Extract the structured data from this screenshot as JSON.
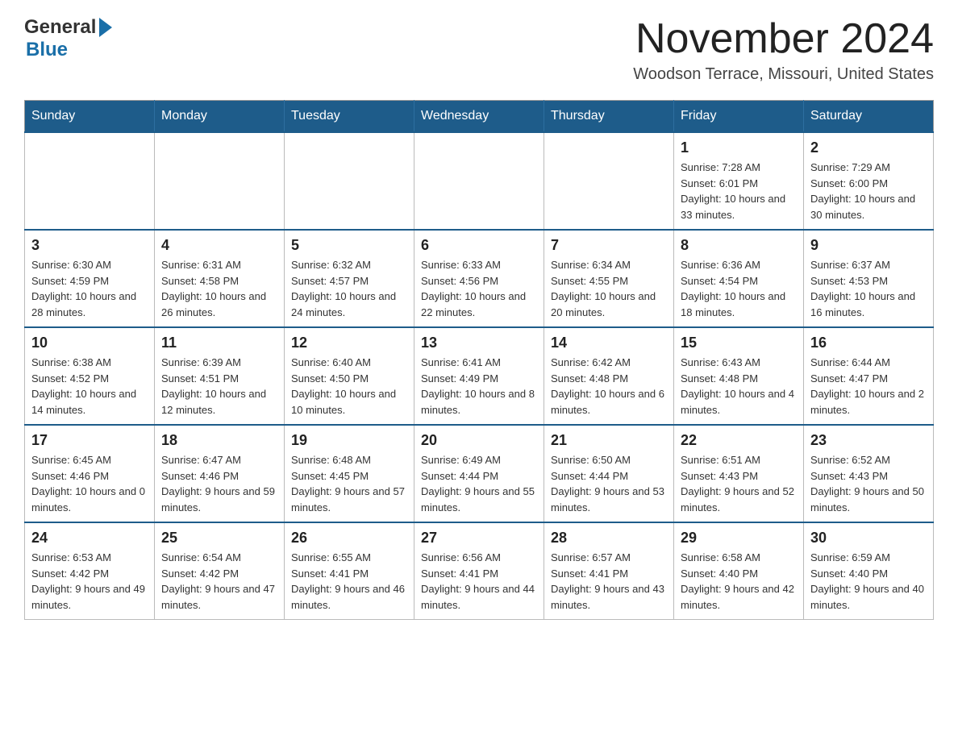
{
  "header": {
    "logo_general": "General",
    "logo_blue": "Blue",
    "month_title": "November 2024",
    "location": "Woodson Terrace, Missouri, United States"
  },
  "weekdays": [
    "Sunday",
    "Monday",
    "Tuesday",
    "Wednesday",
    "Thursday",
    "Friday",
    "Saturday"
  ],
  "weeks": [
    [
      {
        "day": "",
        "info": ""
      },
      {
        "day": "",
        "info": ""
      },
      {
        "day": "",
        "info": ""
      },
      {
        "day": "",
        "info": ""
      },
      {
        "day": "",
        "info": ""
      },
      {
        "day": "1",
        "info": "Sunrise: 7:28 AM\nSunset: 6:01 PM\nDaylight: 10 hours and 33 minutes."
      },
      {
        "day": "2",
        "info": "Sunrise: 7:29 AM\nSunset: 6:00 PM\nDaylight: 10 hours and 30 minutes."
      }
    ],
    [
      {
        "day": "3",
        "info": "Sunrise: 6:30 AM\nSunset: 4:59 PM\nDaylight: 10 hours and 28 minutes."
      },
      {
        "day": "4",
        "info": "Sunrise: 6:31 AM\nSunset: 4:58 PM\nDaylight: 10 hours and 26 minutes."
      },
      {
        "day": "5",
        "info": "Sunrise: 6:32 AM\nSunset: 4:57 PM\nDaylight: 10 hours and 24 minutes."
      },
      {
        "day": "6",
        "info": "Sunrise: 6:33 AM\nSunset: 4:56 PM\nDaylight: 10 hours and 22 minutes."
      },
      {
        "day": "7",
        "info": "Sunrise: 6:34 AM\nSunset: 4:55 PM\nDaylight: 10 hours and 20 minutes."
      },
      {
        "day": "8",
        "info": "Sunrise: 6:36 AM\nSunset: 4:54 PM\nDaylight: 10 hours and 18 minutes."
      },
      {
        "day": "9",
        "info": "Sunrise: 6:37 AM\nSunset: 4:53 PM\nDaylight: 10 hours and 16 minutes."
      }
    ],
    [
      {
        "day": "10",
        "info": "Sunrise: 6:38 AM\nSunset: 4:52 PM\nDaylight: 10 hours and 14 minutes."
      },
      {
        "day": "11",
        "info": "Sunrise: 6:39 AM\nSunset: 4:51 PM\nDaylight: 10 hours and 12 minutes."
      },
      {
        "day": "12",
        "info": "Sunrise: 6:40 AM\nSunset: 4:50 PM\nDaylight: 10 hours and 10 minutes."
      },
      {
        "day": "13",
        "info": "Sunrise: 6:41 AM\nSunset: 4:49 PM\nDaylight: 10 hours and 8 minutes."
      },
      {
        "day": "14",
        "info": "Sunrise: 6:42 AM\nSunset: 4:48 PM\nDaylight: 10 hours and 6 minutes."
      },
      {
        "day": "15",
        "info": "Sunrise: 6:43 AM\nSunset: 4:48 PM\nDaylight: 10 hours and 4 minutes."
      },
      {
        "day": "16",
        "info": "Sunrise: 6:44 AM\nSunset: 4:47 PM\nDaylight: 10 hours and 2 minutes."
      }
    ],
    [
      {
        "day": "17",
        "info": "Sunrise: 6:45 AM\nSunset: 4:46 PM\nDaylight: 10 hours and 0 minutes."
      },
      {
        "day": "18",
        "info": "Sunrise: 6:47 AM\nSunset: 4:46 PM\nDaylight: 9 hours and 59 minutes."
      },
      {
        "day": "19",
        "info": "Sunrise: 6:48 AM\nSunset: 4:45 PM\nDaylight: 9 hours and 57 minutes."
      },
      {
        "day": "20",
        "info": "Sunrise: 6:49 AM\nSunset: 4:44 PM\nDaylight: 9 hours and 55 minutes."
      },
      {
        "day": "21",
        "info": "Sunrise: 6:50 AM\nSunset: 4:44 PM\nDaylight: 9 hours and 53 minutes."
      },
      {
        "day": "22",
        "info": "Sunrise: 6:51 AM\nSunset: 4:43 PM\nDaylight: 9 hours and 52 minutes."
      },
      {
        "day": "23",
        "info": "Sunrise: 6:52 AM\nSunset: 4:43 PM\nDaylight: 9 hours and 50 minutes."
      }
    ],
    [
      {
        "day": "24",
        "info": "Sunrise: 6:53 AM\nSunset: 4:42 PM\nDaylight: 9 hours and 49 minutes."
      },
      {
        "day": "25",
        "info": "Sunrise: 6:54 AM\nSunset: 4:42 PM\nDaylight: 9 hours and 47 minutes."
      },
      {
        "day": "26",
        "info": "Sunrise: 6:55 AM\nSunset: 4:41 PM\nDaylight: 9 hours and 46 minutes."
      },
      {
        "day": "27",
        "info": "Sunrise: 6:56 AM\nSunset: 4:41 PM\nDaylight: 9 hours and 44 minutes."
      },
      {
        "day": "28",
        "info": "Sunrise: 6:57 AM\nSunset: 4:41 PM\nDaylight: 9 hours and 43 minutes."
      },
      {
        "day": "29",
        "info": "Sunrise: 6:58 AM\nSunset: 4:40 PM\nDaylight: 9 hours and 42 minutes."
      },
      {
        "day": "30",
        "info": "Sunrise: 6:59 AM\nSunset: 4:40 PM\nDaylight: 9 hours and 40 minutes."
      }
    ]
  ]
}
